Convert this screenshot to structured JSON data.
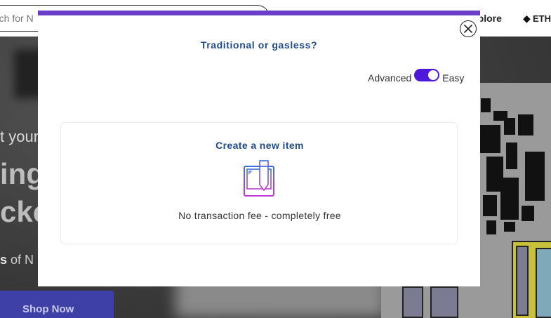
{
  "background": {
    "search_placeholder": "rch for N",
    "nav_explore": "tplore",
    "nav_eth": "ETH",
    "hero_line1": "t your",
    "hero_line2": "ing",
    "hero_line3": "ckc",
    "hero_line4_bold": "s",
    "hero_line4_rest": " of N",
    "shop_button": "Shop Now"
  },
  "modal": {
    "title": "Traditional or gasless?",
    "mode_toggle": {
      "left_label": "Advanced",
      "right_label": "Easy",
      "state": "easy"
    },
    "option": {
      "title": "Create a new item",
      "icon": "pencil-notepad-icon",
      "description": "No transaction fee - completely free"
    },
    "close_icon": "close-icon"
  },
  "colors": {
    "accent_purple": "#6c3fc9",
    "toggle_on": "#4f17d9",
    "title_blue": "#1f4b8c"
  }
}
